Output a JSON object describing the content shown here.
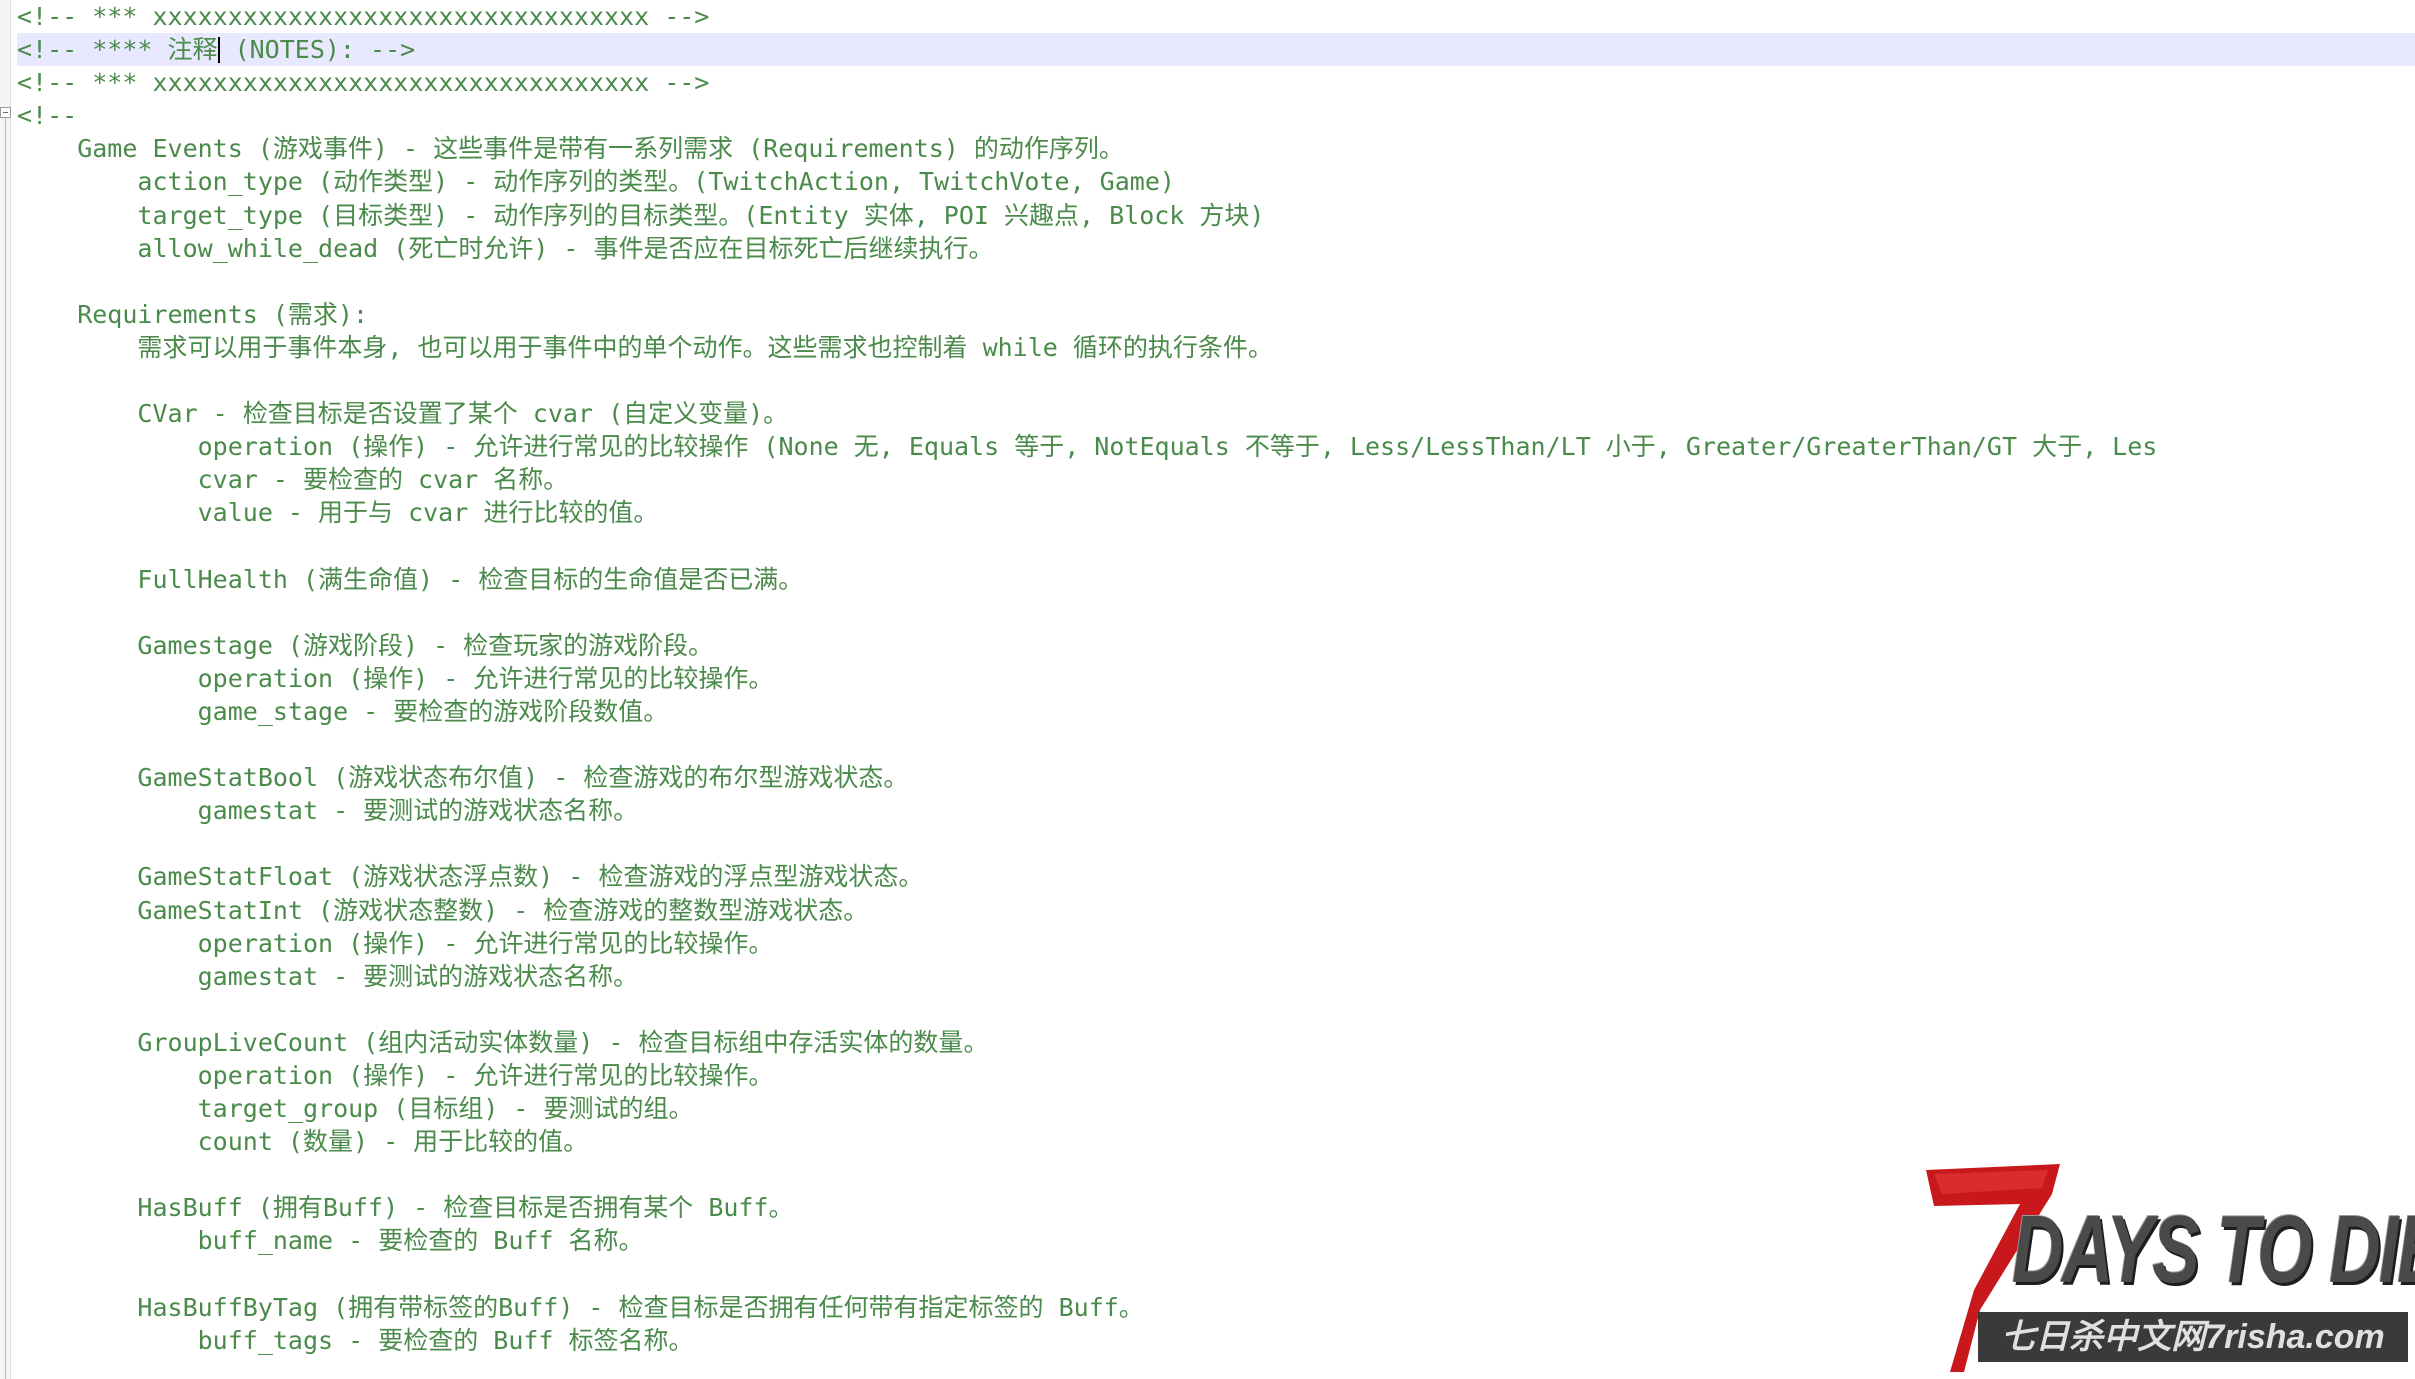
{
  "editor": {
    "lines": [
      "<!-- *** xxxxxxxxxxxxxxxxxxxxxxxxxxxxxxxxx -->",
      "<!-- **** 注释",
      "<!-- *** xxxxxxxxxxxxxxxxxxxxxxxxxxxxxxxxx -->",
      "<!--",
      "    Game Events (游戏事件) - 这些事件是带有一系列需求 (Requirements) 的动作序列。",
      "        action_type (动作类型) - 动作序列的类型。(TwitchAction, TwitchVote, Game)",
      "        target_type (目标类型) - 动作序列的目标类型。(Entity 实体, POI 兴趣点, Block 方块)",
      "        allow_while_dead (死亡时允许) - 事件是否应在目标死亡后继续执行。",
      "",
      "    Requirements (需求):",
      "        需求可以用于事件本身, 也可以用于事件中的单个动作。这些需求也控制着 while 循环的执行条件。",
      "",
      "        CVar - 检查目标是否设置了某个 cvar (自定义变量)。",
      "            operation (操作) - 允许进行常见的比较操作 (None 无, Equals 等于, NotEquals 不等于, Less/LessThan/LT 小于, Greater/GreaterThan/GT 大于, Les",
      "            cvar - 要检查的 cvar 名称。",
      "            value - 用于与 cvar 进行比较的值。",
      "",
      "        FullHealth (满生命值) - 检查目标的生命值是否已满。",
      "",
      "        Gamestage (游戏阶段) - 检查玩家的游戏阶段。",
      "            operation (操作) - 允许进行常见的比较操作。",
      "            game_stage - 要检查的游戏阶段数值。",
      "",
      "        GameStatBool (游戏状态布尔值) - 检查游戏的布尔型游戏状态。",
      "            gamestat - 要测试的游戏状态名称。",
      "",
      "        GameStatFloat (游戏状态浮点数) - 检查游戏的浮点型游戏状态。",
      "        GameStatInt (游戏状态整数) - 检查游戏的整数型游戏状态。",
      "            operation (操作) - 允许进行常见的比较操作。",
      "            gamestat - 要测试的游戏状态名称。",
      "",
      "        GroupLiveCount (组内活动实体数量) - 检查目标组中存活实体的数量。",
      "            operation (操作) - 允许进行常见的比较操作。",
      "            target_group (目标组) - 要测试的组。",
      "            count (数量) - 用于比较的值。",
      "",
      "        HasBuff (拥有Buff) - 检查目标是否拥有某个 Buff。",
      "            buff_name - 要检查的 Buff 名称。",
      "",
      "        HasBuffByTag (拥有带标签的Buff) - 检查目标是否拥有任何带有指定标签的 Buff。",
      "            buff_tags - 要检查的 Buff 标签名称。"
    ],
    "current_line_suffix": " (NOTES): -->"
  },
  "watermark": {
    "title": "DAYS TO DIE",
    "subtitle": "七日杀中文网7risha.com"
  }
}
